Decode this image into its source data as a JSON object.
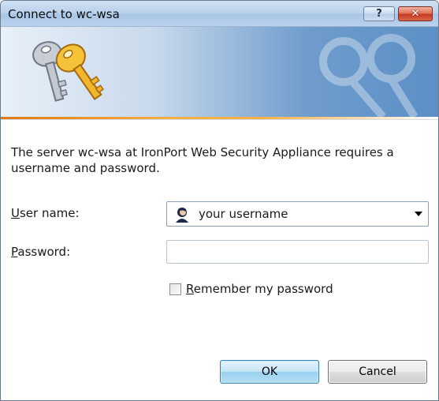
{
  "window": {
    "title": "Connect to wc-wsa",
    "help_label": "?",
    "close_label": "✕"
  },
  "message": "The server wc-wsa at IronPort Web Security Appliance requires a username and password.",
  "username": {
    "label_accel": "U",
    "label_rest": "ser name:",
    "value": "your username"
  },
  "password": {
    "label_accel": "P",
    "label_rest": "assword:",
    "value": ""
  },
  "remember": {
    "label_accel": "R",
    "label_rest": "emember my password",
    "checked": false
  },
  "buttons": {
    "ok": "OK",
    "cancel": "Cancel"
  },
  "colors": {
    "accent_orange": "#f6b048",
    "banner_blue": "#5c8fc6",
    "close_red": "#c8391e"
  }
}
